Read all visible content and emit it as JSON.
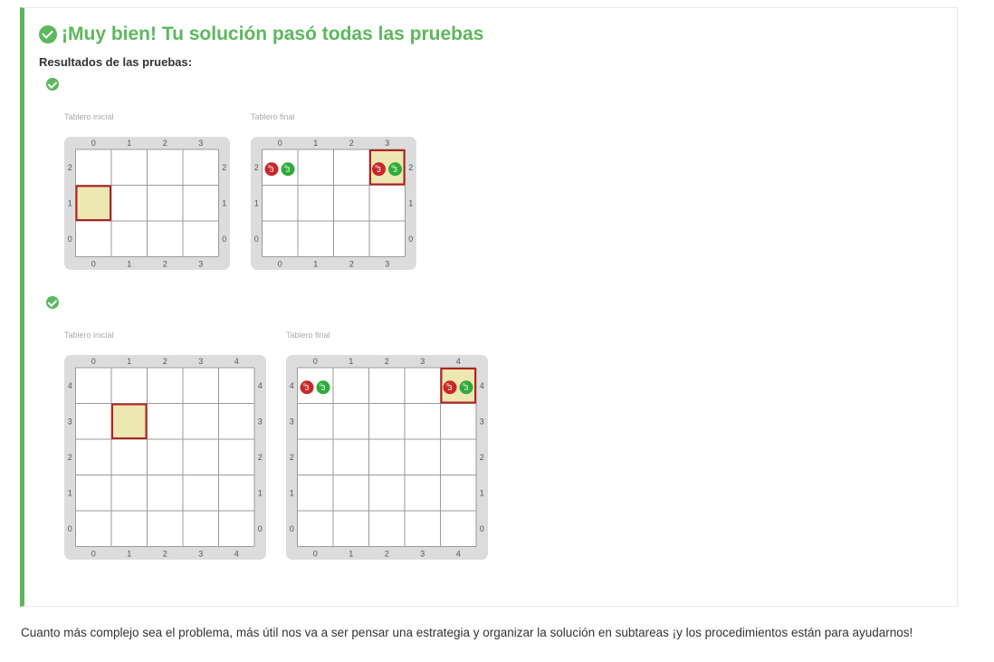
{
  "result": {
    "title": "¡Muy bien! Tu solución pasó todas las pruebas",
    "subtitle": "Resultados de las pruebas:",
    "icon": "check-circle-icon",
    "accent": "#5cb85c"
  },
  "tests": [
    {
      "status": "passed",
      "initial": {
        "caption": "Tablero inicial",
        "cols": 4,
        "rows": 3,
        "head": {
          "col": 0,
          "row": 1
        },
        "balls": []
      },
      "final": {
        "caption": "Tablero final",
        "cols": 4,
        "rows": 3,
        "head": {
          "col": 3,
          "row": 2
        },
        "balls": [
          {
            "col": 0,
            "row": 2,
            "red": 3,
            "green": 3
          },
          {
            "col": 3,
            "row": 2,
            "red": 3,
            "green": 3
          }
        ]
      }
    },
    {
      "status": "passed",
      "initial": {
        "caption": "Tablero inicial",
        "cols": 5,
        "rows": 5,
        "head": {
          "col": 1,
          "row": 3
        },
        "balls": []
      },
      "final": {
        "caption": "Tablero final",
        "cols": 5,
        "rows": 5,
        "head": {
          "col": 4,
          "row": 4
        },
        "balls": [
          {
            "col": 0,
            "row": 4,
            "red": 3,
            "green": 3
          },
          {
            "col": 4,
            "row": 4,
            "red": 3,
            "green": 3
          }
        ]
      }
    }
  ],
  "colors": {
    "head_fill": "#ede7b1",
    "head_border": "#b22222",
    "red_ball": "#c62828",
    "green_ball": "#2eaa3a"
  },
  "footer": "Cuanto más complejo sea el problema, más útil nos va a ser pensar una estrategia y organizar la solución en subtareas ¡y los procedimientos están para ayudarnos!"
}
